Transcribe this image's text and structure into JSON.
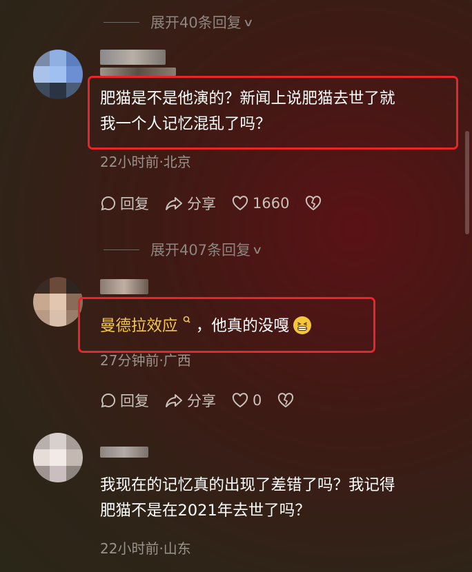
{
  "thread1": {
    "expand_label": "展开40条回复",
    "comment_lines": [
      "肥猫是不是他演的？新闻上说肥猫去世了就",
      "我一个人记忆混乱了吗？"
    ],
    "meta": "22小时前·北京",
    "reply_label": "回复",
    "share_label": "分享",
    "like_count": "1660"
  },
  "thread2": {
    "expand_label": "展开407条回复",
    "link_text": "曼德拉效应",
    "comment_rest": "，他真的没嘎",
    "meta": "27分钟前·广西",
    "reply_label": "回复",
    "share_label": "分享",
    "like_count": "0"
  },
  "thread3": {
    "comment_lines": [
      "我现在的记忆真的出现了差错了吗？我记得",
      "肥猫不是在2021年去世了吗？"
    ],
    "meta": "22小时前·山东"
  },
  "colors": {
    "highlight_box": "#e8262a",
    "link": "#f2c64b"
  },
  "icons": [
    "chevron-down-icon",
    "comment-icon",
    "share-icon",
    "heart-icon",
    "broken-heart-icon",
    "search-icon",
    "grinning-emoji-icon"
  ]
}
